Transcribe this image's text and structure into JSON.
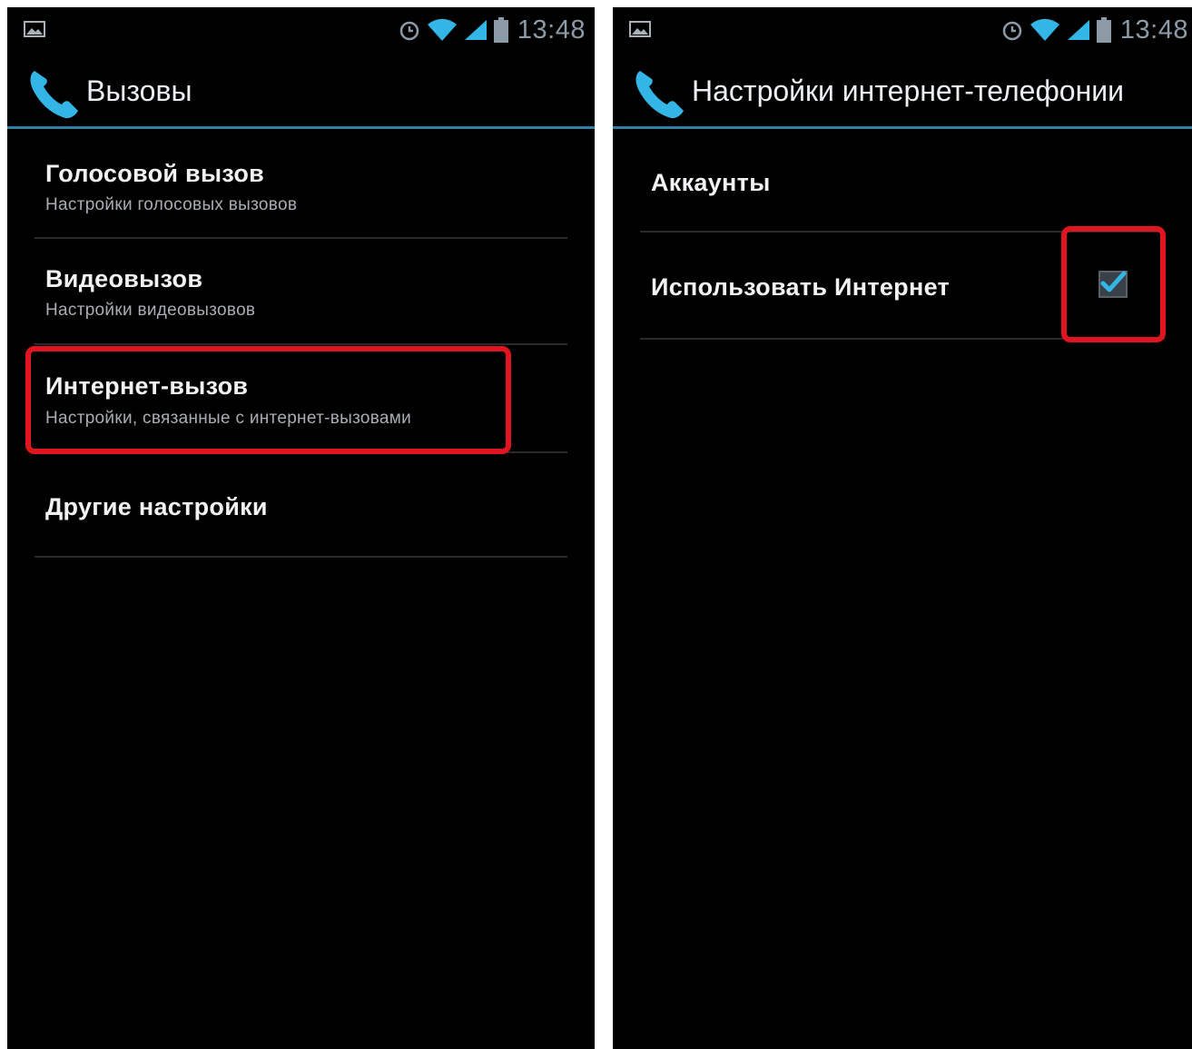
{
  "left_screen": {
    "status_bar": {
      "time": "13:48"
    },
    "action_bar": {
      "title": "Вызовы",
      "icon": "phone-icon"
    },
    "items": [
      {
        "title": "Голосовой вызов",
        "summary": "Настройки голосовых вызовов"
      },
      {
        "title": "Видеовызов",
        "summary": "Настройки видеовызовов"
      },
      {
        "title": "Интернет-вызов",
        "summary": "Настройки, связанные с интернет-вызовами",
        "highlighted": true
      },
      {
        "title": "Другие настройки"
      }
    ]
  },
  "right_screen": {
    "status_bar": {
      "time": "13:48"
    },
    "action_bar": {
      "title": "Настройки интернет-телефонии",
      "icon": "phone-icon"
    },
    "items": [
      {
        "title": "Аккаунты"
      },
      {
        "title": "Использовать Интернет",
        "checked": true,
        "highlighted": true
      }
    ]
  },
  "colors": {
    "accent_divider": "#2f7fa6",
    "highlight_frame": "#e0151f",
    "checkmark": "#33b5e5",
    "background": "#000000"
  }
}
